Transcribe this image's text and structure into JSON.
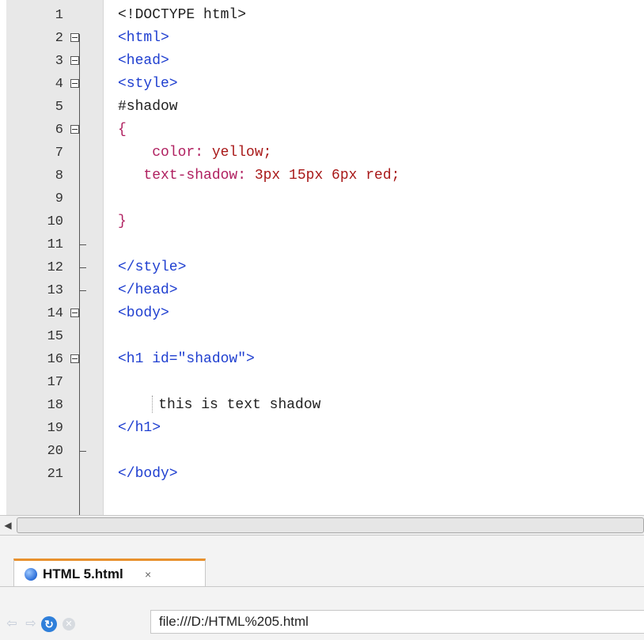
{
  "editor": {
    "lines": [
      {
        "n": "1",
        "code": [
          {
            "t": "<!DOCTYPE html>",
            "c": "plain"
          }
        ]
      },
      {
        "n": "2",
        "fold": "box",
        "code": [
          {
            "t": "<html>",
            "c": "tag"
          }
        ]
      },
      {
        "n": "3",
        "fold": "box",
        "code": [
          {
            "t": "<head>",
            "c": "tag"
          }
        ]
      },
      {
        "n": "4",
        "fold": "box",
        "code": [
          {
            "t": "<style>",
            "c": "tag"
          }
        ]
      },
      {
        "n": "5",
        "code": [
          {
            "t": "#shadow",
            "c": "sel"
          }
        ]
      },
      {
        "n": "6",
        "fold": "box",
        "code": [
          {
            "t": "{",
            "c": "prop"
          }
        ]
      },
      {
        "n": "7",
        "code": [
          {
            "t": "    color: ",
            "c": "prop"
          },
          {
            "t": "yellow;",
            "c": "val"
          }
        ]
      },
      {
        "n": "8",
        "code": [
          {
            "t": "   text-shadow: ",
            "c": "prop"
          },
          {
            "t": "3px 15px 6px red;",
            "c": "val"
          }
        ]
      },
      {
        "n": "9",
        "code": []
      },
      {
        "n": "10",
        "code": [
          {
            "t": "}",
            "c": "prop"
          }
        ]
      },
      {
        "n": "11",
        "fold": "tick",
        "code": []
      },
      {
        "n": "12",
        "fold": "tick",
        "code": [
          {
            "t": "</style>",
            "c": "tag"
          }
        ]
      },
      {
        "n": "13",
        "fold": "tick",
        "code": [
          {
            "t": "</head>",
            "c": "tag"
          }
        ]
      },
      {
        "n": "14",
        "fold": "box",
        "code": [
          {
            "t": "<body>",
            "c": "tag"
          }
        ]
      },
      {
        "n": "15",
        "code": []
      },
      {
        "n": "16",
        "fold": "box",
        "code": [
          {
            "t": "<h1 id=\"shadow\">",
            "c": "tag"
          }
        ]
      },
      {
        "n": "17",
        "code": []
      },
      {
        "n": "18",
        "guide": true,
        "code": [
          {
            "t": "this is text shadow",
            "c": "plain"
          }
        ]
      },
      {
        "n": "19",
        "code": [
          {
            "t": "</h1>",
            "c": "tag"
          }
        ]
      },
      {
        "n": "20",
        "fold": "tick",
        "code": []
      },
      {
        "n": "21",
        "code": [
          {
            "t": "</body>",
            "c": "tag"
          }
        ]
      }
    ]
  },
  "tab": {
    "label": "HTML 5.html",
    "close": "×"
  },
  "address": {
    "url": "file:///D:/HTML%205.html"
  },
  "icons": {
    "back": "arrow-left-icon",
    "forward": "arrow-right-icon",
    "reload": "reload-icon",
    "stop": "stop-icon",
    "file": "html-file-icon"
  }
}
